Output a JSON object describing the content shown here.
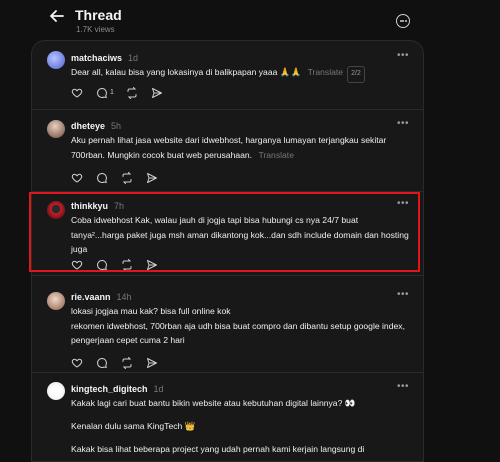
{
  "header": {
    "title": "Thread",
    "views": "1.7K views"
  },
  "posts": [
    {
      "username": "matchaciws",
      "time": "1d",
      "text": "Dear all, kalau bisa yang lokasinya di balikpapan yaaa 🙏🙏",
      "translate": "Translate",
      "translate_badge": "2/2",
      "reply_count": "1"
    },
    {
      "username": "dheteye",
      "time": "5h",
      "text": "Aku pernah lihat jasa website dari idwebhost, harganya lumayan terjangkau sekitar 700rban. Mungkin cocok buat web perusahaan.",
      "translate": "Translate"
    },
    {
      "username": "thinkkyu",
      "time": "7h",
      "text": "Coba idwebhost Kak, walau jauh di jogja tapi bisa hubungi cs nya 24/7 buat tanya²...harga paket juga msh aman dikantong kok...dan sdh include domain dan hosting juga"
    },
    {
      "username": "rie.vaann",
      "time": "14h",
      "line1": "lokasi jogjaa mau kak? bisa full online kok",
      "line2": "rekomen idwebhost, 700rban aja udh bisa buat compro dan dibantu setup google index, pengerjaan cepet cuma 2 hari"
    },
    {
      "username": "kingtech_digitech",
      "time": "1d",
      "line1": "Kakak lagi cari buat bantu bikin website atau kebutuhan digital lainnya? 👀",
      "line2": "Kenalan dulu sama KingTech 👑",
      "line3": "Kakak bisa lihat beberapa project yang udah pernah kami kerjain langsung di"
    }
  ],
  "icons": [
    "back-arrow-icon",
    "more-circle-icon",
    "more-dots-icon",
    "heart-icon",
    "comment-icon",
    "repost-icon",
    "share-icon"
  ],
  "colors": {
    "background": "#101010",
    "card": "#181818",
    "highlight": "#e0151e"
  }
}
